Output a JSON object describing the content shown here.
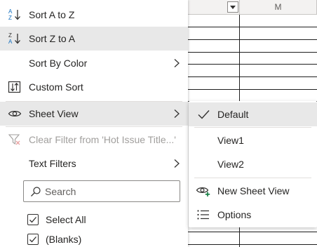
{
  "sheet": {
    "columns": [
      {
        "label": ""
      },
      {
        "label": "M"
      }
    ]
  },
  "menu": {
    "sort_a_to_z": "Sort A to Z",
    "sort_z_to_a": "Sort Z to A",
    "sort_by_color": "Sort By Color",
    "custom_sort": "Custom Sort",
    "sheet_view": "Sheet View",
    "clear_filter": "Clear Filter from 'Hot Issue Title...'",
    "text_filters": "Text Filters",
    "search_placeholder": "Search",
    "checklist": [
      {
        "label": "Select All",
        "checked": true
      },
      {
        "label": "(Blanks)",
        "checked": true
      }
    ]
  },
  "submenu": {
    "default": "Default",
    "view1": "View1",
    "view2": "View2",
    "new_sheet_view": "New Sheet View",
    "options": "Options"
  },
  "icons": {
    "sort_az": "sort-ascending-icon",
    "sort_za": "sort-descending-icon",
    "custom_sort": "custom-sort-icon",
    "sheet_view": "eye-icon",
    "clear_filter": "clear-filter-icon",
    "search": "search-icon",
    "default_check": "checkmark-icon",
    "new_sheet_view": "eye-plus-icon",
    "options": "list-options-icon"
  },
  "colors": {
    "hover_bg": "#e8e8e8",
    "accent_green": "#107c41",
    "az_blue": "#0f6cbd"
  }
}
